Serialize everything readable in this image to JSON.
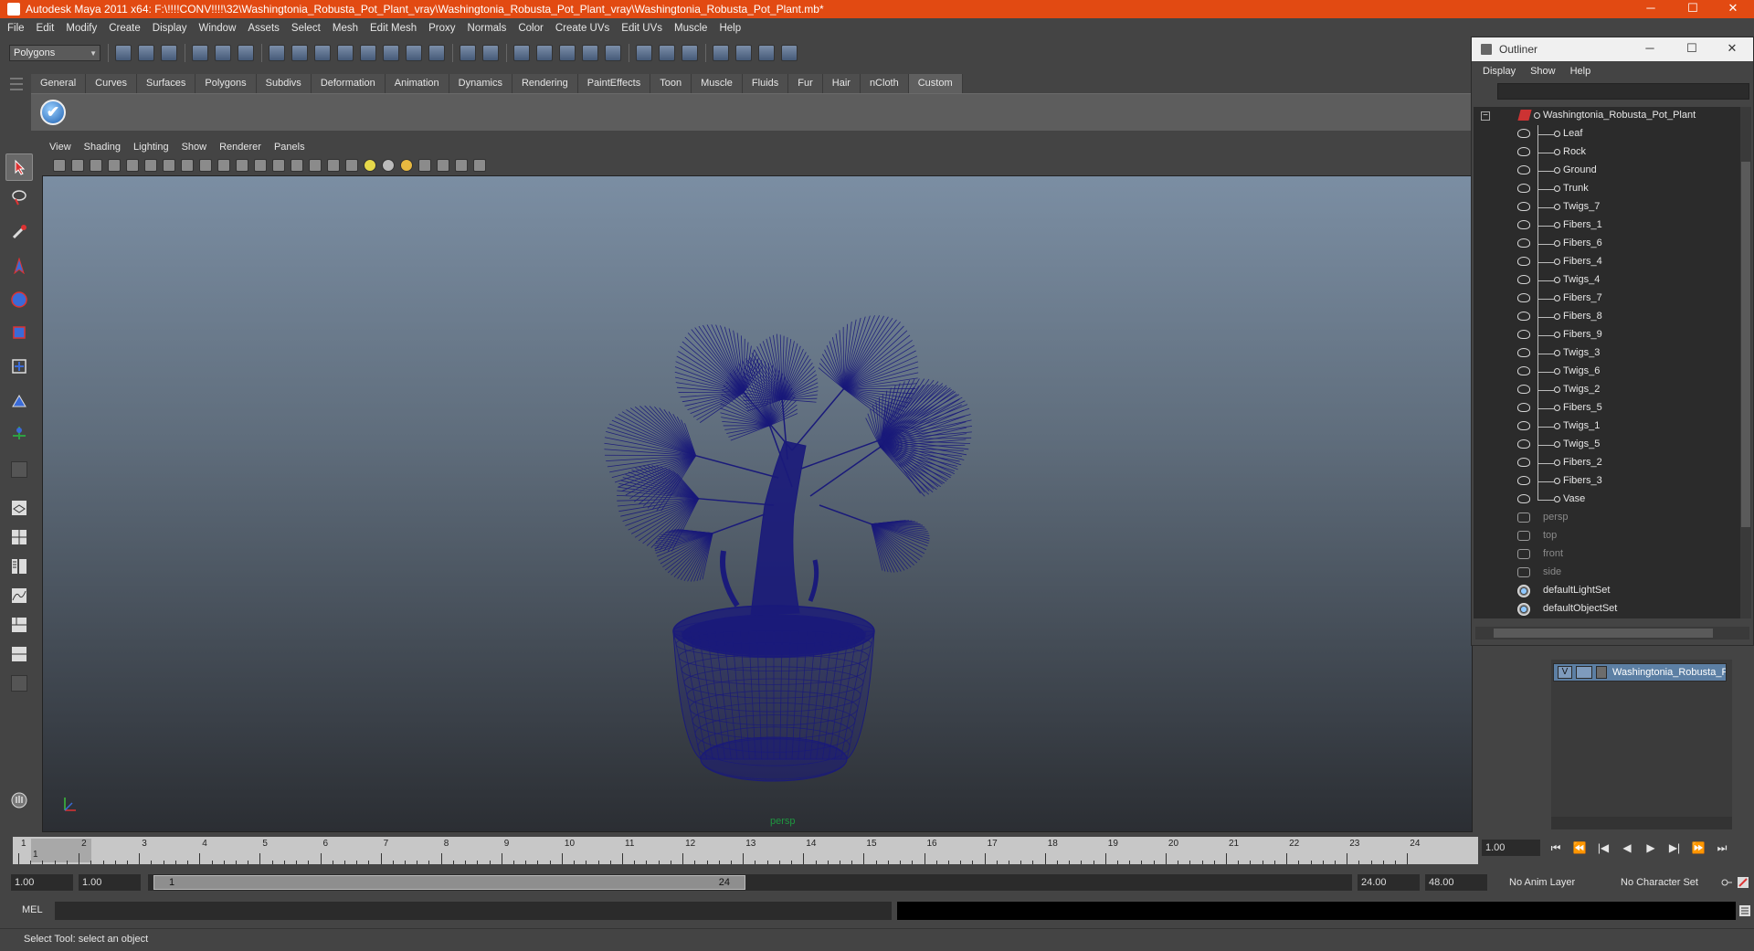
{
  "window": {
    "title": "Autodesk Maya 2011 x64: F:\\!!!!CONV!!!!\\32\\Washingtonia_Robusta_Pot_Plant_vray\\Washingtonia_Robusta_Pot_Plant_vray\\Washingtonia_Robusta_Pot_Plant.mb*",
    "controls": [
      "─",
      "☐",
      "✕"
    ],
    "accent_color": "#e24a12"
  },
  "menubar": [
    "File",
    "Edit",
    "Modify",
    "Create",
    "Display",
    "Window",
    "Assets",
    "Select",
    "Mesh",
    "Edit Mesh",
    "Proxy",
    "Normals",
    "Color",
    "Create UVs",
    "Edit UVs",
    "Muscle",
    "Help"
  ],
  "statusline": {
    "mode": "Polygons"
  },
  "shelf": {
    "tabs": [
      "General",
      "Curves",
      "Surfaces",
      "Polygons",
      "Subdivs",
      "Deformation",
      "Animation",
      "Dynamics",
      "Rendering",
      "PaintEffects",
      "Toon",
      "Muscle",
      "Fluids",
      "Fur",
      "Hair",
      "nCloth",
      "Custom"
    ],
    "active_tab": "Custom",
    "check_icon": "✔"
  },
  "panel": {
    "menus": [
      "View",
      "Shading",
      "Lighting",
      "Show",
      "Renderer",
      "Panels"
    ],
    "camera": "persp",
    "wire_color": "#1a1a7a"
  },
  "outliner": {
    "title": "Outliner",
    "controls": [
      "─",
      "☐",
      "✕"
    ],
    "menus": [
      "Display",
      "Show",
      "Help"
    ],
    "collapse": "−",
    "root": "Washingtonia_Robusta_Pot_Plant",
    "children": [
      "Leaf",
      "Rock",
      "Ground",
      "Trunk",
      "Twigs_7",
      "Fibers_1",
      "Fibers_6",
      "Fibers_4",
      "Twigs_4",
      "Fibers_7",
      "Fibers_8",
      "Fibers_9",
      "Twigs_3",
      "Twigs_6",
      "Twigs_2",
      "Fibers_5",
      "Twigs_1",
      "Twigs_5",
      "Fibers_2",
      "Fibers_3",
      "Vase"
    ],
    "cameras": [
      "persp",
      "top",
      "front",
      "side"
    ],
    "sets": [
      "defaultLightSet",
      "defaultObjectSet"
    ]
  },
  "layers": {
    "visible": "V",
    "name": "Washingtonia_Robusta_Pot_Plant"
  },
  "timeslider": {
    "ticks": [
      "1",
      "2",
      "3",
      "4",
      "5",
      "6",
      "7",
      "8",
      "9",
      "10",
      "11",
      "12",
      "13",
      "14",
      "15",
      "16",
      "17",
      "18",
      "19",
      "20",
      "21",
      "22",
      "23",
      "24"
    ],
    "current_frame_label": "1",
    "current_frame": "1.00",
    "play_controls": [
      "⏮",
      "⏪",
      "|◀",
      "◀",
      "▶",
      "▶|",
      "⏩",
      "⏭"
    ]
  },
  "range": {
    "start": "1.00",
    "playback_start": "1.00",
    "thumb_start": "1",
    "thumb_end": "24",
    "playback_end": "24.00",
    "end": "48.00",
    "anim_layer": "No Anim Layer",
    "character_set": "No Character Set"
  },
  "mel": {
    "label": "MEL"
  },
  "help": {
    "text": "Select Tool: select an object"
  }
}
